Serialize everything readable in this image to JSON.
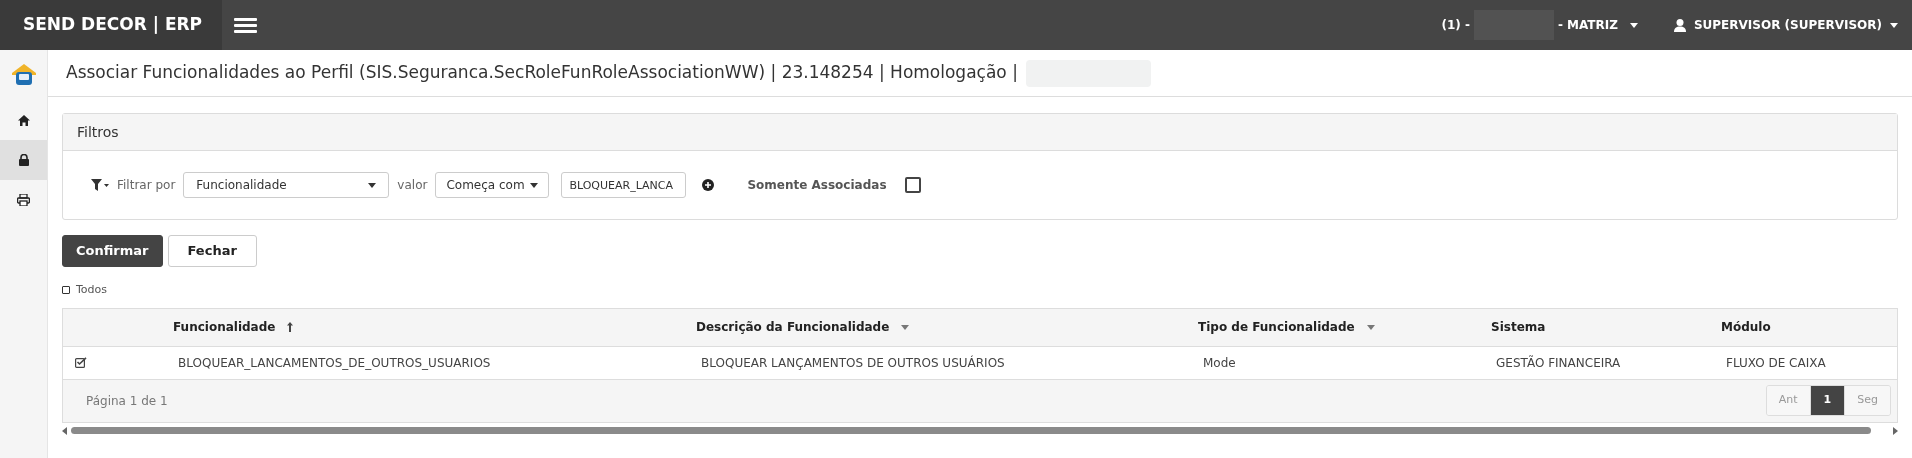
{
  "topbar": {
    "brand": "SEND DECOR | ERP",
    "company_prefix": "(1) -",
    "company_suffix": "- MATRIZ",
    "user": "SUPERVISOR (SUPERVISOR)"
  },
  "sidebar": {
    "items": [
      {
        "kind": "logo",
        "selected": false
      },
      {
        "kind": "home",
        "selected": false
      },
      {
        "kind": "lock",
        "selected": true
      },
      {
        "kind": "print",
        "selected": false
      }
    ]
  },
  "page_title": {
    "text": "Associar Funcionalidades ao Perfil (SIS.Seguranca.SecRoleFunRoleAssociationWW) | 23.148254 | Homologação |"
  },
  "filters": {
    "title": "Filtros",
    "filter_by_label": "Filtrar por",
    "filter_by_value": "Funcionalidade",
    "value_label": "valor",
    "operator_value": "Começa com",
    "search_value": "BLOQUEAR_LANCA",
    "only_associated_label": "Somente Associadas",
    "only_associated_checked": false
  },
  "buttons": [
    {
      "label": "Confirmar",
      "kind": "primary"
    },
    {
      "label": "Fechar",
      "kind": "default"
    }
  ],
  "select_all": {
    "label": "Todos",
    "checked": false
  },
  "table": {
    "columns": [
      {
        "label": "Funcionalidade",
        "kind": "sorted"
      },
      {
        "label": "Descrição da Funcionalidade",
        "kind": "menu"
      },
      {
        "label": "Tipo de Funcionalidade",
        "kind": "menu"
      },
      {
        "label": "Sistema",
        "kind": "plain"
      },
      {
        "label": "Módulo",
        "kind": "plain"
      }
    ],
    "rows": [
      {
        "checked": true,
        "cells": [
          "BLOQUEAR_LANCAMENTOS_DE_OUTROS_USUARIOS",
          "BLOQUEAR LANÇAMENTOS DE OUTROS USUÁRIOS",
          "Mode",
          "GESTÃO FINANCEIRA",
          "FLUXO DE CAIXA"
        ]
      }
    ],
    "page_info": "Página 1 de 1",
    "pager": [
      {
        "label": "Ant",
        "selected": false
      },
      {
        "label": "1",
        "selected": true
      },
      {
        "label": "Seg",
        "selected": false
      }
    ]
  }
}
